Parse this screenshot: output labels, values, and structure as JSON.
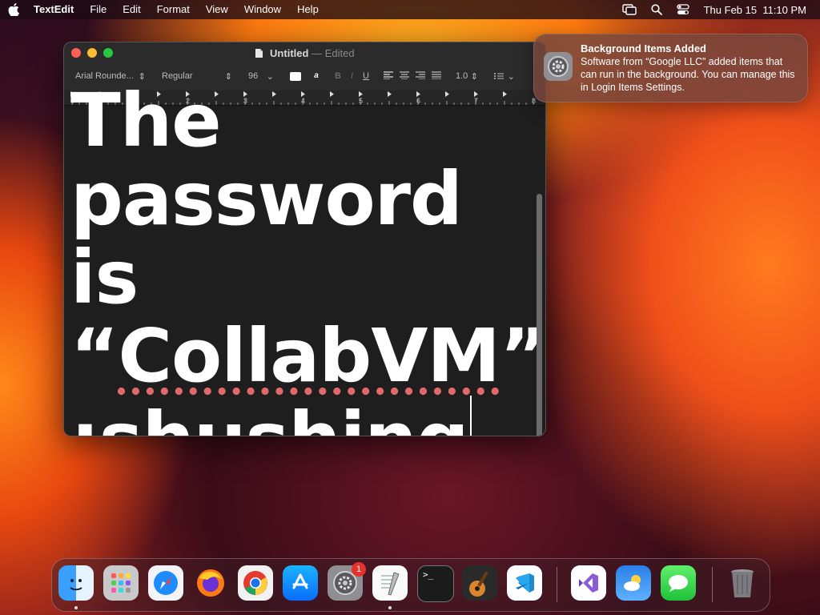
{
  "menubar": {
    "app_name": "TextEdit",
    "menus": [
      "File",
      "Edit",
      "Format",
      "View",
      "Window",
      "Help"
    ],
    "datetime": "Thu Feb 15  11:10 PM"
  },
  "window": {
    "title": "Untitled",
    "title_separator": "—",
    "edited_label": "Edited",
    "toolbar": {
      "font_family": "Arial Rounde...",
      "font_style": "Regular",
      "font_size": "96",
      "line_spacing": "1.0"
    },
    "ruler_labels": [
      "0",
      "1",
      "2",
      "3",
      "4",
      "5",
      "6",
      "7",
      "8"
    ],
    "document": {
      "lines": [
        "The",
        "password is",
        "“CollabVM”",
        ":shushing"
      ],
      "misspelled_word": "CollabVM"
    }
  },
  "notification": {
    "title": "Background Items Added",
    "body": "Software from “Google LLC” added items that can run in the background. You can manage this in Login Items Settings."
  },
  "dock": {
    "system_settings_badge": "1",
    "apps": [
      "finder",
      "launchpad",
      "safari",
      "firefox",
      "chrome",
      "app-store",
      "system-settings",
      "textedit",
      "terminal",
      "garageband",
      "vscode",
      "visual-studio",
      "weather",
      "messages",
      "trash"
    ]
  },
  "colors": {
    "close": "#ff5f57",
    "minimize": "#febc2e",
    "zoom": "#28c840",
    "badge": "#e5322d"
  }
}
